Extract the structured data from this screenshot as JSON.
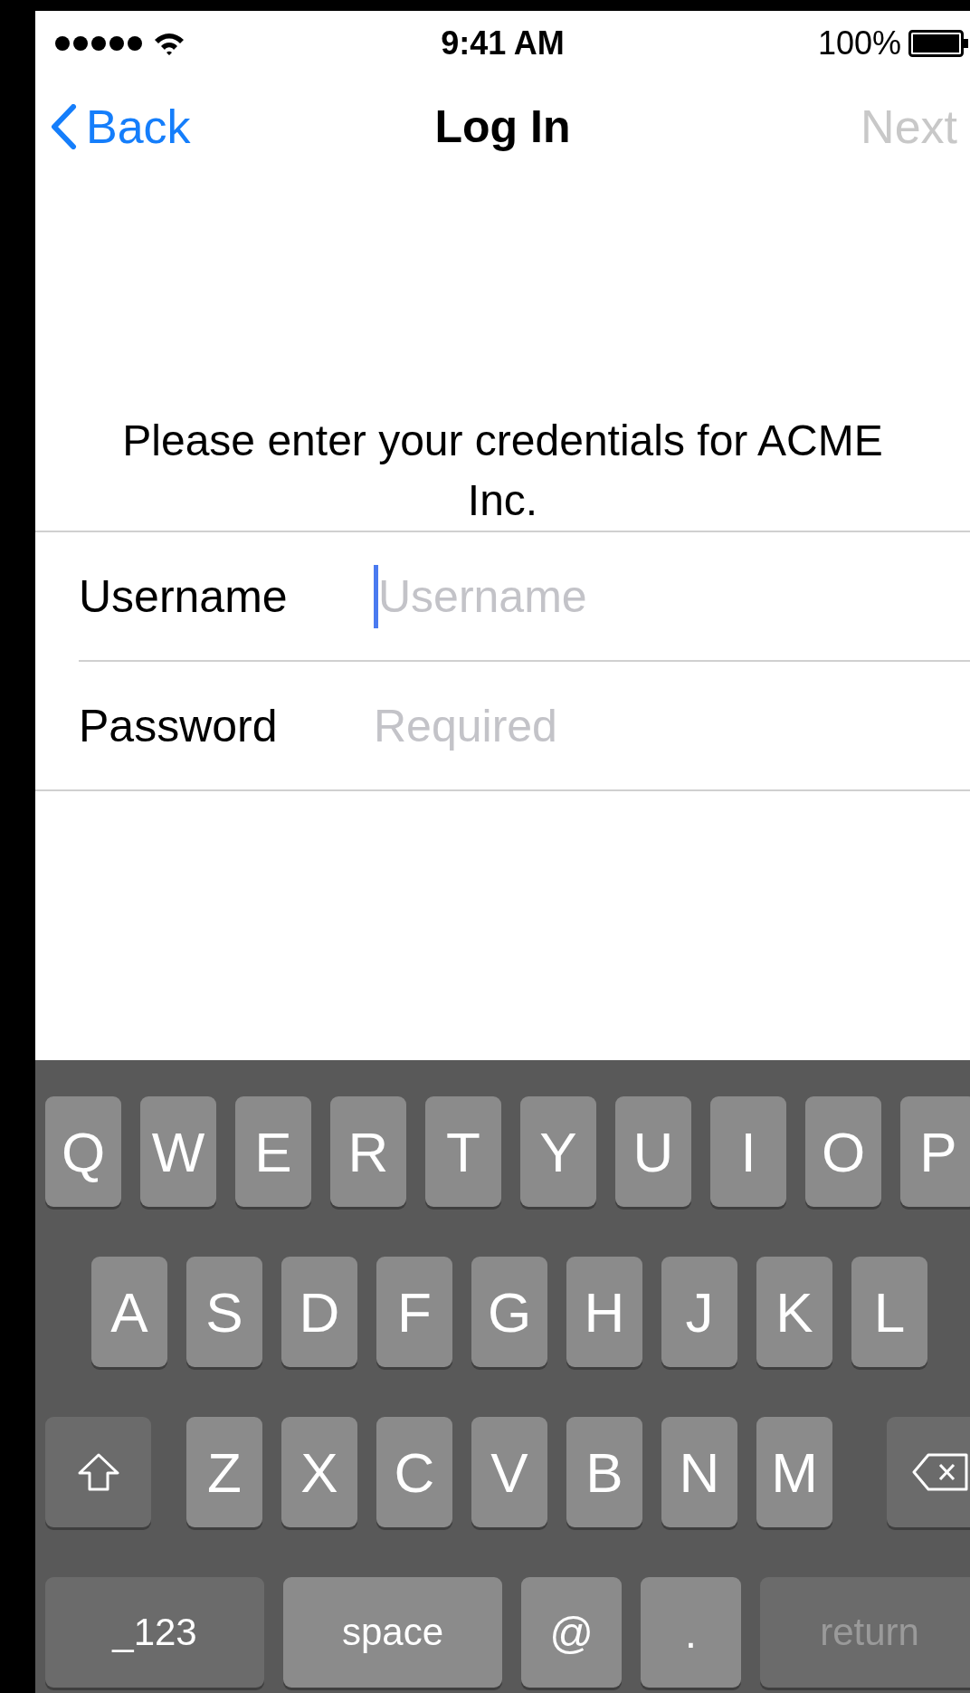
{
  "status_bar": {
    "time": "9:41 AM",
    "battery": "100%"
  },
  "nav": {
    "back": "Back",
    "title": "Log In",
    "next": {
      "label": "Next",
      "disabled": true
    }
  },
  "prompt": "Please enter your credentials for ACME Inc.",
  "fields": [
    {
      "label": "Username",
      "placeholder": "Username",
      "focused": true
    },
    {
      "label": "Password",
      "placeholder": "Required",
      "focused": false
    }
  ],
  "keyboard": {
    "rows": [
      [
        {
          "kind": "letter",
          "label": "Q"
        },
        {
          "kind": "letter",
          "label": "W"
        },
        {
          "kind": "letter",
          "label": "E"
        },
        {
          "kind": "letter",
          "label": "R"
        },
        {
          "kind": "letter",
          "label": "T"
        },
        {
          "kind": "letter",
          "label": "Y"
        },
        {
          "kind": "letter",
          "label": "U"
        },
        {
          "kind": "letter",
          "label": "I"
        },
        {
          "kind": "letter",
          "label": "O"
        },
        {
          "kind": "letter",
          "label": "P"
        }
      ],
      [
        {
          "kind": "letter",
          "label": "A"
        },
        {
          "kind": "letter",
          "label": "S"
        },
        {
          "kind": "letter",
          "label": "D"
        },
        {
          "kind": "letter",
          "label": "F"
        },
        {
          "kind": "letter",
          "label": "G"
        },
        {
          "kind": "letter",
          "label": "H"
        },
        {
          "kind": "letter",
          "label": "J"
        },
        {
          "kind": "letter",
          "label": "K"
        },
        {
          "kind": "letter",
          "label": "L"
        }
      ],
      [
        {
          "kind": "shift"
        },
        {
          "kind": "letter",
          "label": "Z"
        },
        {
          "kind": "letter",
          "label": "X"
        },
        {
          "kind": "letter",
          "label": "C"
        },
        {
          "kind": "letter",
          "label": "V"
        },
        {
          "kind": "letter",
          "label": "B"
        },
        {
          "kind": "letter",
          "label": "N"
        },
        {
          "kind": "letter",
          "label": "M"
        },
        {
          "kind": "delete"
        }
      ]
    ],
    "bottom_row": [
      {
        "kind": "numbers",
        "label": "_123",
        "disabled": false
      },
      {
        "kind": "space",
        "label": "space",
        "disabled": false
      },
      {
        "kind": "symbol",
        "label": "@",
        "disabled": false
      },
      {
        "kind": "symbol",
        "label": ".",
        "disabled": false
      },
      {
        "kind": "return",
        "label": "return",
        "disabled": true
      }
    ]
  }
}
